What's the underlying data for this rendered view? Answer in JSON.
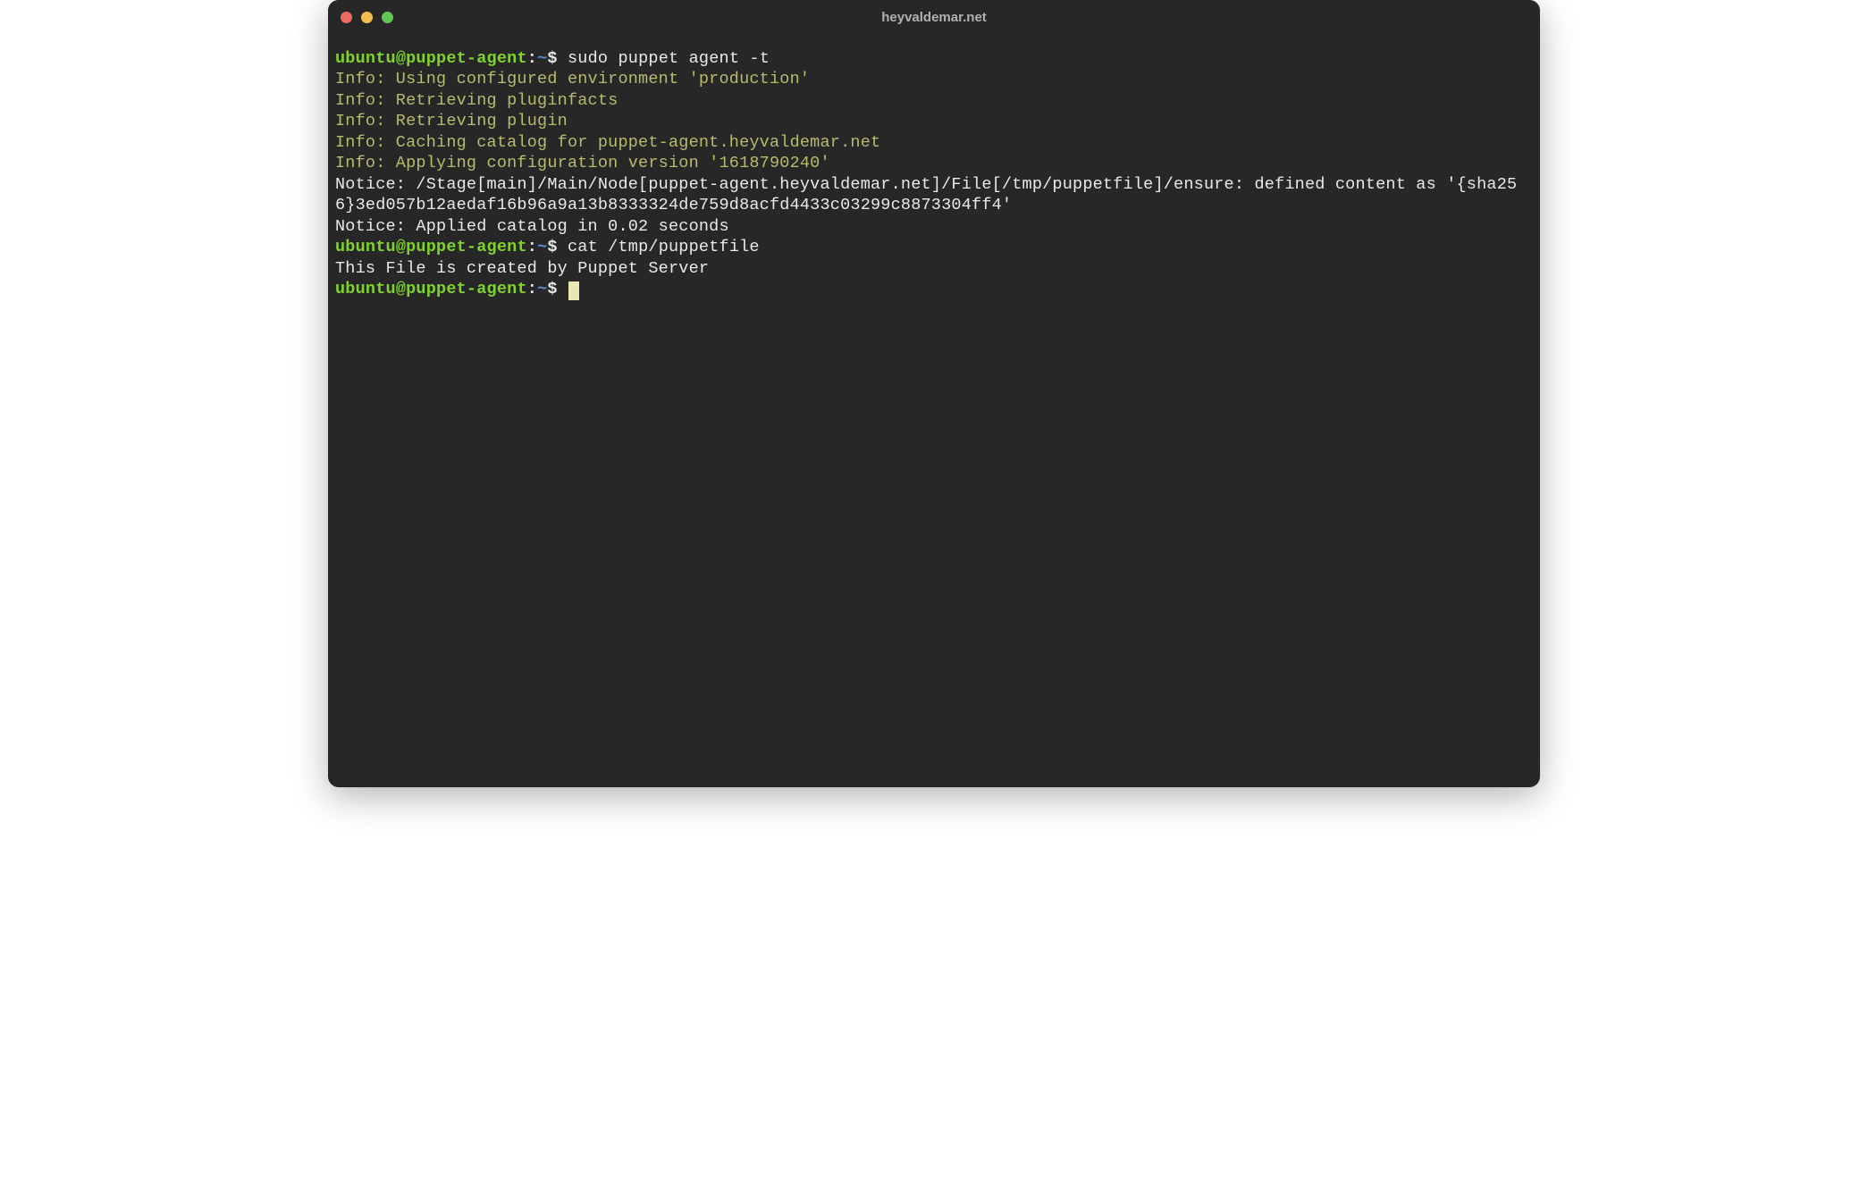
{
  "window": {
    "title": "heyvaldemar.net"
  },
  "colors": {
    "background": "#272727",
    "text": "#e9e9e9",
    "prompt_user": "#7fd32a",
    "prompt_path": "#5a8dce",
    "info": "#b7bb6b",
    "cursor": "#ebe6b5",
    "traffic_close": "#ed6a5e",
    "traffic_min": "#f5bf4f",
    "traffic_max": "#62c554"
  },
  "prompt": {
    "user": "ubuntu",
    "at": "@",
    "host": "puppet-agent",
    "colon": ":",
    "path": "~",
    "symbol": "$"
  },
  "lines": {
    "cmd1": " sudo puppet agent -t",
    "info1": "Info: Using configured environment 'production'",
    "info2": "Info: Retrieving pluginfacts",
    "info3": "Info: Retrieving plugin",
    "info4": "Info: Caching catalog for puppet-agent.heyvaldemar.net",
    "info5": "Info: Applying configuration version '1618790240'",
    "notice1": "Notice: /Stage[main]/Main/Node[puppet-agent.heyvaldemar.net]/File[/tmp/puppetfile]/ensure: defined content as '{sha256}3ed057b12aedaf16b96a9a13b8333324de759d8acfd4433c03299c8873304ff4'",
    "notice2": "Notice: Applied catalog in 0.02 seconds",
    "cmd2": " cat /tmp/puppetfile",
    "output1": "This File is created by Puppet Server",
    "cmd3": " "
  }
}
